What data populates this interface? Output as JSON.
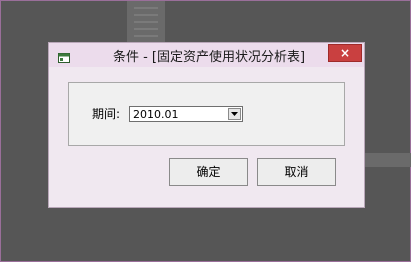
{
  "dialog": {
    "title": "条件 - [固定资产使用状况分析表]",
    "close_label": "×",
    "period_label": "期间:",
    "period_value": "2010.01",
    "ok_label": "确定",
    "cancel_label": "取消",
    "icons": {
      "window": "window-icon",
      "close": "close-icon",
      "dropdown": "chevron-down-icon"
    },
    "colors": {
      "close": "#c94040",
      "titlebar": "#ecdcec"
    }
  }
}
